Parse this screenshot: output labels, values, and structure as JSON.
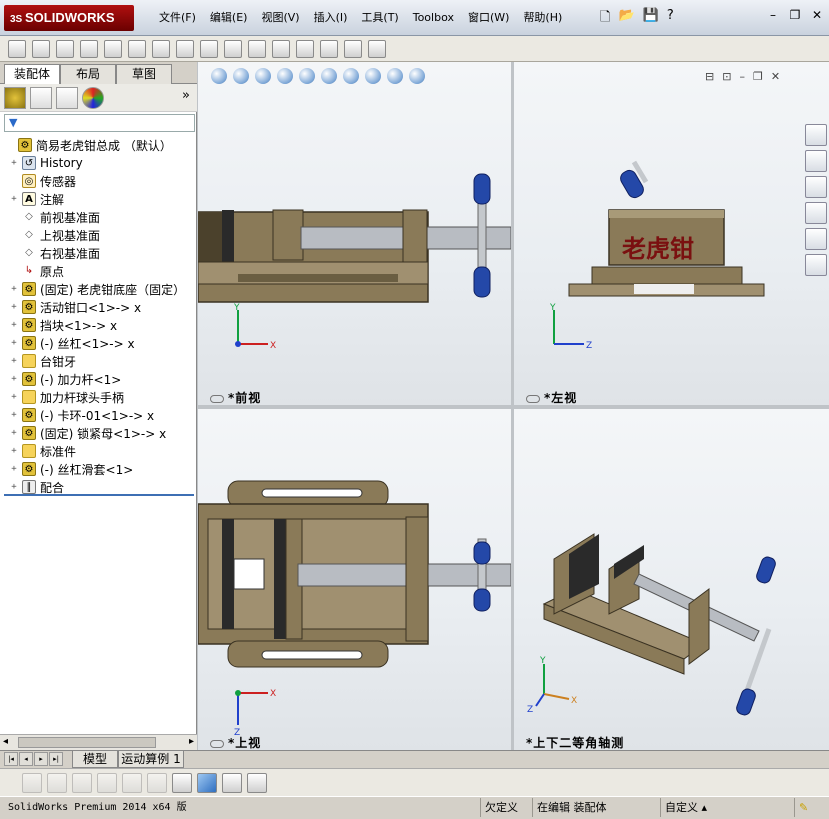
{
  "app": {
    "logo_text": "SOLIDWORKS",
    "brand_color": "#a00000"
  },
  "menu": [
    "文件(F)",
    "编辑(E)",
    "视图(V)",
    "插入(I)",
    "工具(T)",
    "Toolbox",
    "窗口(W)",
    "帮助(H)"
  ],
  "window_controls": {
    "minimize": "–",
    "restore": "❐",
    "close": "✕"
  },
  "quick_access": {
    "new": "🗋",
    "open": "📂",
    "save": "💾",
    "help": "?"
  },
  "panel": {
    "tabs": [
      "装配体",
      "布局",
      "草图"
    ],
    "expand_glyph": "»",
    "filter_icon": "filter-icon"
  },
  "tree": [
    {
      "label": "简易老虎钳总成  （默认）",
      "icon": "asm",
      "expander": "",
      "indent": 0
    },
    {
      "label": "History",
      "icon": "hist",
      "expander": "+",
      "indent": 1
    },
    {
      "label": "传感器",
      "icon": "sens",
      "expander": "",
      "indent": 1
    },
    {
      "label": "注解",
      "icon": "note",
      "expander": "+",
      "indent": 1
    },
    {
      "label": "前视基准面",
      "icon": "plane",
      "expander": "",
      "indent": 1
    },
    {
      "label": "上视基准面",
      "icon": "plane",
      "expander": "",
      "indent": 1
    },
    {
      "label": "右视基准面",
      "icon": "plane",
      "expander": "",
      "indent": 1
    },
    {
      "label": "原点",
      "icon": "origin",
      "expander": "",
      "indent": 1
    },
    {
      "label": "(固定) 老虎钳底座（固定）",
      "icon": "asm",
      "expander": "+",
      "indent": 1
    },
    {
      "label": "活动钳口<1>-> x",
      "icon": "asm",
      "expander": "+",
      "indent": 1
    },
    {
      "label": "挡块<1>-> x",
      "icon": "asm",
      "expander": "+",
      "indent": 1
    },
    {
      "label": "(-) 丝杠<1>-> x",
      "icon": "asm",
      "expander": "+",
      "indent": 1
    },
    {
      "label": "台钳牙",
      "icon": "folder",
      "expander": "+",
      "indent": 1
    },
    {
      "label": "(-) 加力杆<1>",
      "icon": "asm",
      "expander": "+",
      "indent": 1
    },
    {
      "label": "加力杆球头手柄",
      "icon": "folder",
      "expander": "+",
      "indent": 1
    },
    {
      "label": "(-) 卡环-01<1>-> x",
      "icon": "asm",
      "expander": "+",
      "indent": 1
    },
    {
      "label": "(固定) 锁紧母<1>-> x",
      "icon": "asm",
      "expander": "+",
      "indent": 1
    },
    {
      "label": "标准件",
      "icon": "folder",
      "expander": "+",
      "indent": 1
    },
    {
      "label": "(-) 丝杠滑套<1>",
      "icon": "asm",
      "expander": "+",
      "indent": 1
    },
    {
      "label": "配合",
      "icon": "mate",
      "expander": "+",
      "indent": 1
    }
  ],
  "views": {
    "front": {
      "label": "*前视",
      "axis1": "Y",
      "axis2": "X"
    },
    "left": {
      "label": "*左视",
      "axis1": "Y",
      "axis2": "Z",
      "engraving": "老虎钳"
    },
    "top": {
      "label": "*上视",
      "axis1": "X",
      "axis2": "Z"
    },
    "iso": {
      "label": "*上下二等角轴测",
      "axis1": "Y",
      "axis2": "X",
      "axis3": "Z"
    }
  },
  "bottom_tabs": [
    "模型",
    "运动算例 1"
  ],
  "status": {
    "app": "SolidWorks Premium 2014 x64 版",
    "definition": "欠定义",
    "mode": "在编辑 装配体",
    "units": "自定义",
    "units_arrow": "▴"
  },
  "colors": {
    "part_body": "#8a7a58",
    "part_dark": "#4b412c",
    "rod": "#b8bcc2",
    "handle": "#2448a8",
    "engrave": "#7a1010",
    "axis_x": "#cc2020",
    "axis_y": "#10a040",
    "axis_z": "#2040cc"
  }
}
